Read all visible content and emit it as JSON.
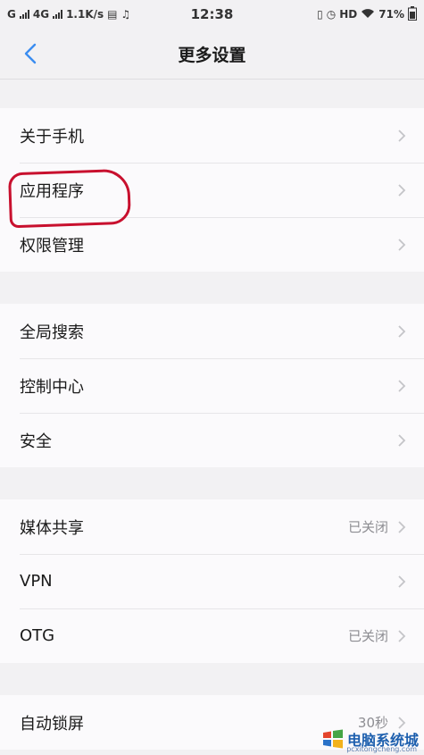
{
  "status_bar": {
    "carrier_left": "G",
    "network": "4G",
    "speed": "1.1K/s",
    "time": "12:38",
    "hd": "HD",
    "battery": "71%"
  },
  "nav": {
    "title": "更多设置",
    "back_icon": "chevron-left-icon"
  },
  "groups": [
    {
      "items": [
        {
          "label": "关于手机",
          "value": ""
        },
        {
          "label": "应用程序",
          "value": ""
        },
        {
          "label": "权限管理",
          "value": ""
        }
      ]
    },
    {
      "items": [
        {
          "label": "全局搜索",
          "value": ""
        },
        {
          "label": "控制中心",
          "value": ""
        },
        {
          "label": "安全",
          "value": ""
        }
      ]
    },
    {
      "items": [
        {
          "label": "媒体共享",
          "value": "已关闭"
        },
        {
          "label": "VPN",
          "value": ""
        },
        {
          "label": "OTG",
          "value": "已关闭"
        }
      ]
    },
    {
      "items": [
        {
          "label": "自动锁屏",
          "value": "30秒"
        }
      ]
    }
  ],
  "watermark": {
    "text": "电脑系统城",
    "url": "pcxitongcheng.com"
  },
  "colors": {
    "accent": "#3b8df0",
    "annotation": "#c8102e",
    "chevron": "#c4c4c8"
  }
}
